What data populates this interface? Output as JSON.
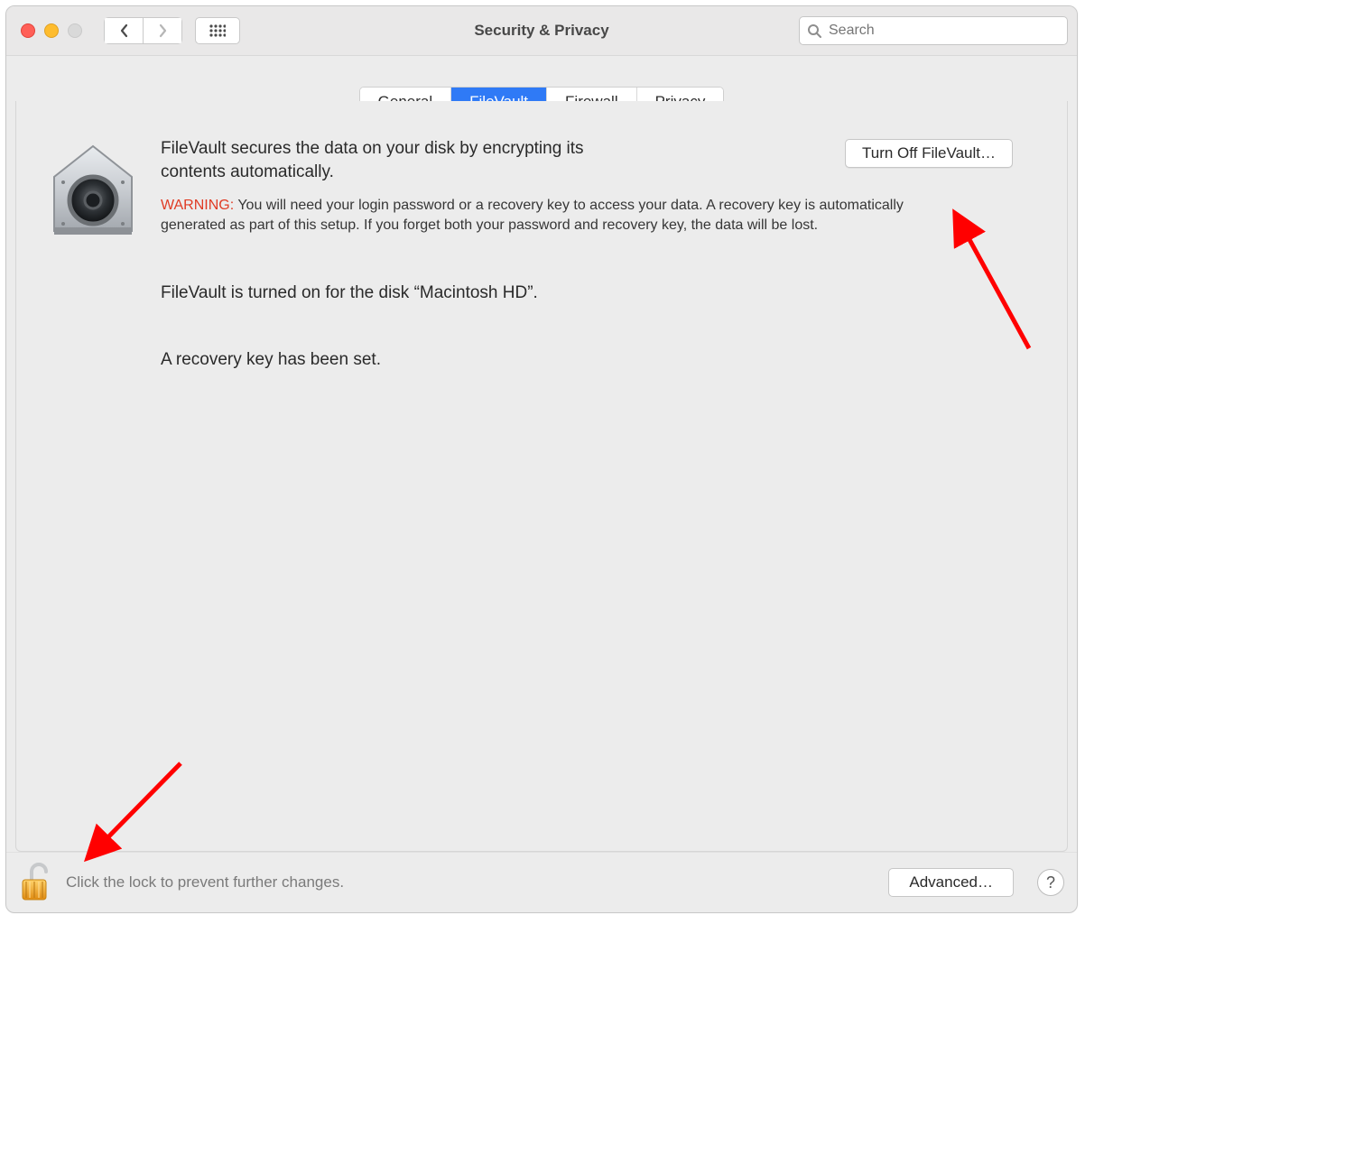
{
  "window": {
    "title": "Security & Privacy",
    "search_placeholder": "Search"
  },
  "tabs": {
    "items": [
      {
        "label": "General",
        "selected": false
      },
      {
        "label": "FileVault",
        "selected": true
      },
      {
        "label": "Firewall",
        "selected": false
      },
      {
        "label": "Privacy",
        "selected": false
      }
    ]
  },
  "filevault": {
    "lead": "FileVault secures the data on your disk by encrypting its contents automatically.",
    "action_label": "Turn Off FileVault…",
    "warning_label": "WARNING:",
    "warning_text": "You will need your login password or a recovery key to access your data. A recovery key is automatically generated as part of this setup. If you forget both your password and recovery key, the data will be lost.",
    "status_on": "FileVault is turned on for the disk “Macintosh HD”.",
    "recovery_status": "A recovery key has been set."
  },
  "footer": {
    "lock_hint": "Click the lock to prevent further changes.",
    "advanced_label": "Advanced…",
    "help_label": "?"
  }
}
